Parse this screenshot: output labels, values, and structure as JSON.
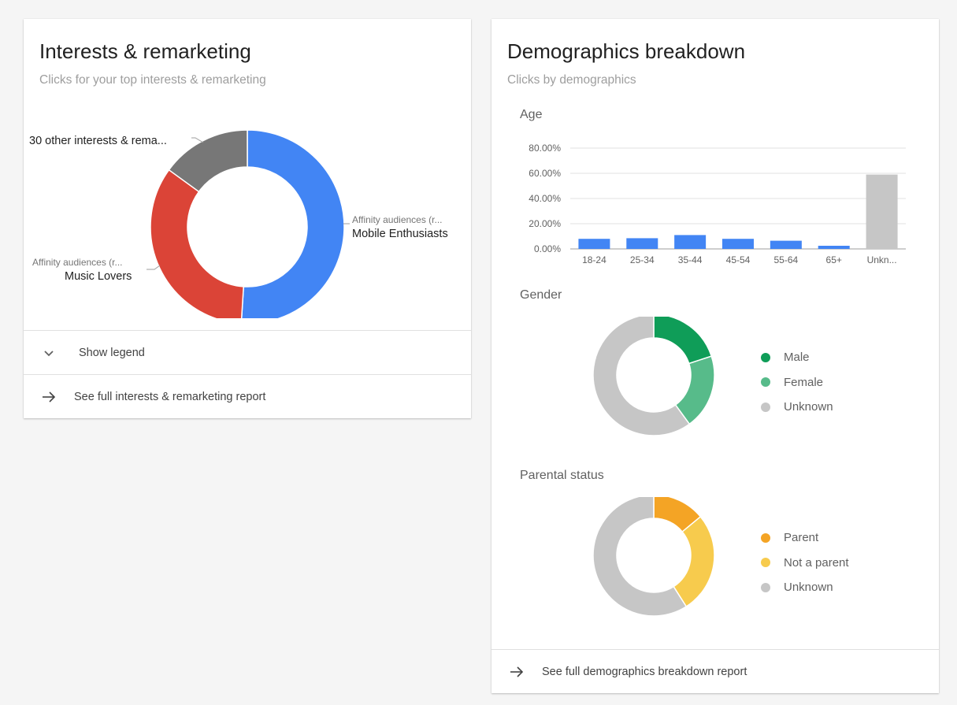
{
  "interests": {
    "title": "Interests & remarketing",
    "subtitle": "Clicks for your top interests & remarketing",
    "show_legend_label": "Show legend",
    "report_link_label": "See full interests & remarketing report",
    "labels": {
      "other": "30 other interests & rema...",
      "mobile_category": "Affinity audiences (r...",
      "mobile_name": "Mobile Enthusiasts",
      "music_category": "Affinity audiences (r...",
      "music_name": "Music Lovers"
    }
  },
  "demographics": {
    "title": "Demographics breakdown",
    "subtitle": "Clicks by demographics",
    "age_label": "Age",
    "gender_label": "Gender",
    "parental_label": "Parental status",
    "report_link_label": "See full demographics breakdown report",
    "gender_legend": [
      {
        "label": "Male",
        "color": "#0f9d58"
      },
      {
        "label": "Female",
        "color": "#57bb8a"
      },
      {
        "label": "Unknown",
        "color": "#c6c6c6"
      }
    ],
    "parental_legend": [
      {
        "label": "Parent",
        "color": "#f4a425"
      },
      {
        "label": "Not a parent",
        "color": "#f7cb4d"
      },
      {
        "label": "Unknown",
        "color": "#c6c6c6"
      }
    ]
  },
  "chart_data": [
    {
      "type": "pie",
      "donut": true,
      "labels": [
        "Mobile Enthusiasts",
        "Music Lovers",
        "30 other interests & rema..."
      ],
      "values": [
        51,
        34,
        15
      ],
      "colors": [
        "#4285f4",
        "#db4437",
        "#777777"
      ]
    },
    {
      "type": "bar",
      "categories": [
        "18-24",
        "25-34",
        "35-44",
        "45-54",
        "55-64",
        "65+",
        "Unkn..."
      ],
      "values": [
        8,
        8.5,
        11,
        8,
        6.5,
        2.5,
        59
      ],
      "colors": [
        "#4285f4",
        "#4285f4",
        "#4285f4",
        "#4285f4",
        "#4285f4",
        "#4285f4",
        "#c6c6c6"
      ],
      "yticks": [
        "0.00%",
        "20.00%",
        "40.00%",
        "60.00%",
        "80.00%"
      ],
      "ylim": [
        0,
        80
      ],
      "grid": true
    },
    {
      "type": "pie",
      "donut": true,
      "labels": [
        "Male",
        "Female",
        "Unknown"
      ],
      "values": [
        20,
        20,
        60
      ],
      "colors": [
        "#0f9d58",
        "#57bb8a",
        "#c6c6c6"
      ]
    },
    {
      "type": "pie",
      "donut": true,
      "labels": [
        "Parent",
        "Not a parent",
        "Unknown"
      ],
      "values": [
        14,
        27,
        59
      ],
      "colors": [
        "#f4a425",
        "#f7cb4d",
        "#c6c6c6"
      ]
    }
  ]
}
